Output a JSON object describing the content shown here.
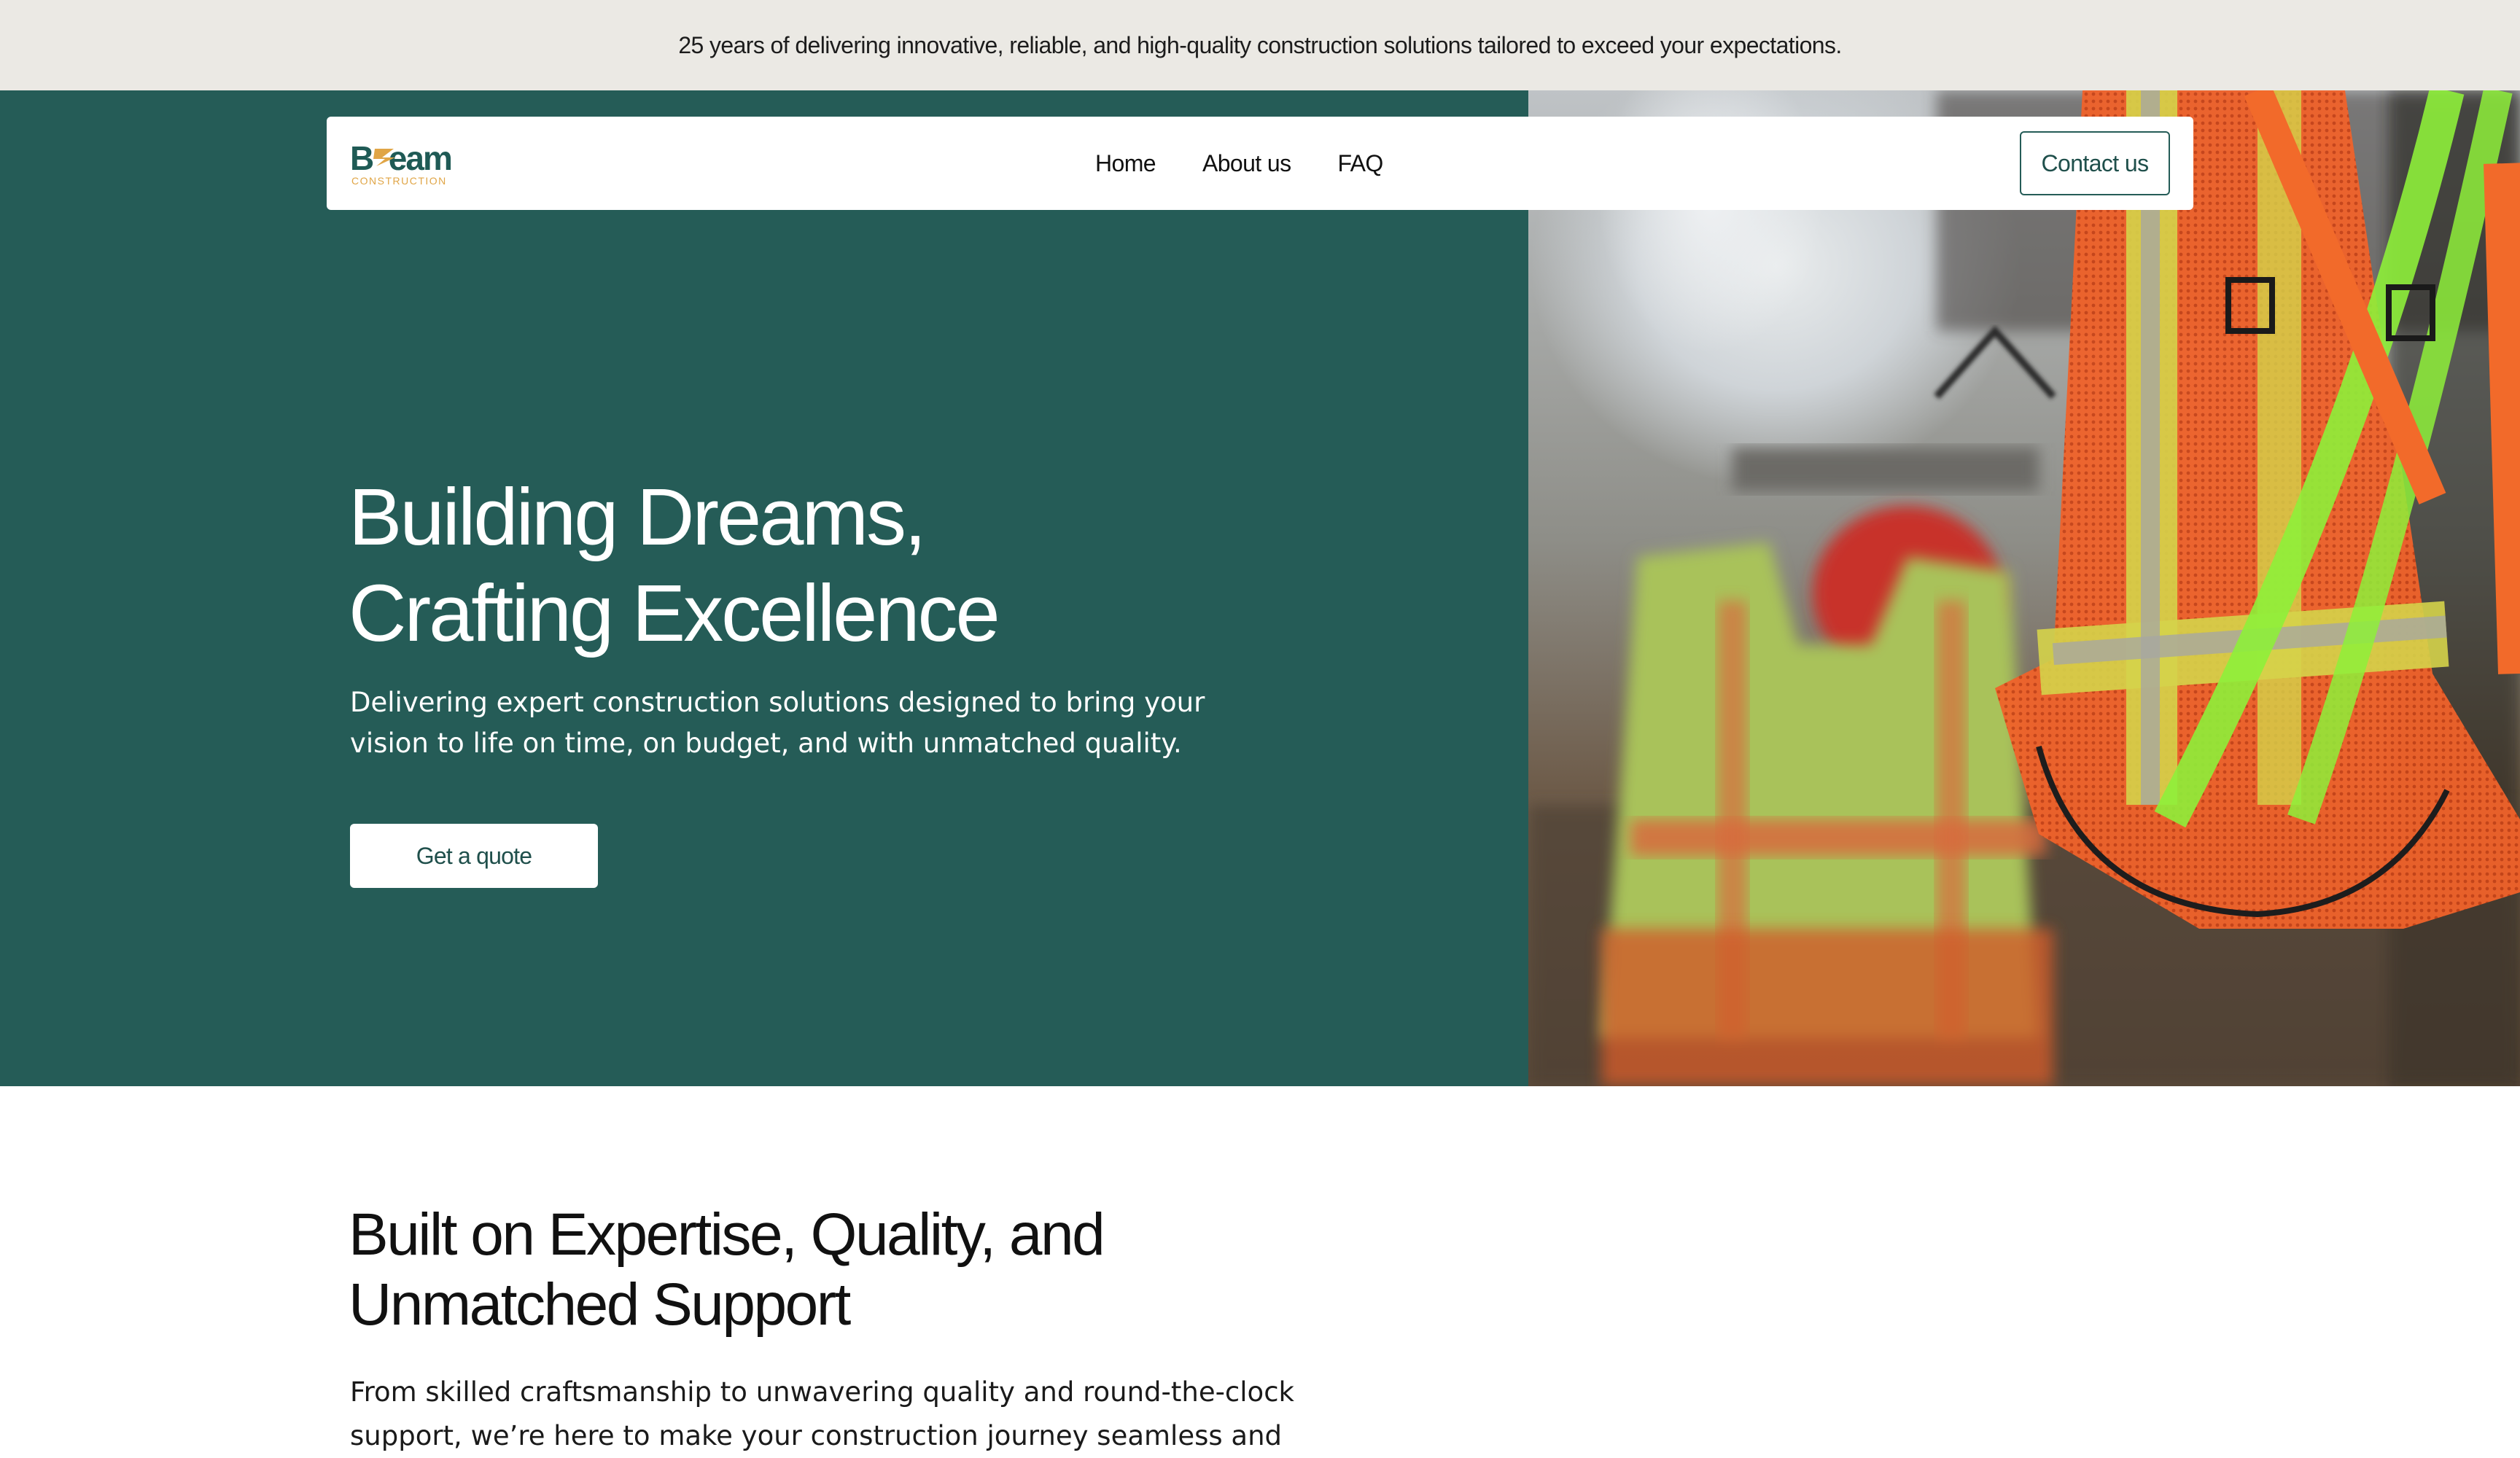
{
  "announcement": {
    "text": "25 years of delivering innovative, reliable, and high-quality construction solutions tailored to exceed your expectations."
  },
  "brand": {
    "name": "Bceam",
    "tagline": "CONSTRUCTION",
    "primary_color": "#255c57",
    "accent_color": "#e0a546"
  },
  "nav": {
    "items": [
      {
        "label": "Home"
      },
      {
        "label": "About us"
      },
      {
        "label": "FAQ"
      }
    ],
    "contact_label": "Contact us"
  },
  "hero": {
    "headline_line1": "Building Dreams,",
    "headline_line2": "Crafting Excellence",
    "lead": "Delivering expert construction solutions designed to bring your vision to life on time, on budget, and with unmatched quality.",
    "cta_label": "Get a quote",
    "image_icon": "safety-vests-photo"
  },
  "about": {
    "title_line1": "Built on Expertise, Quality, and",
    "title_line2": "Unmatched Support",
    "body": "From skilled craftsmanship to unwavering quality and round-the-clock support, we’re here to make your construction journey seamless and"
  }
}
